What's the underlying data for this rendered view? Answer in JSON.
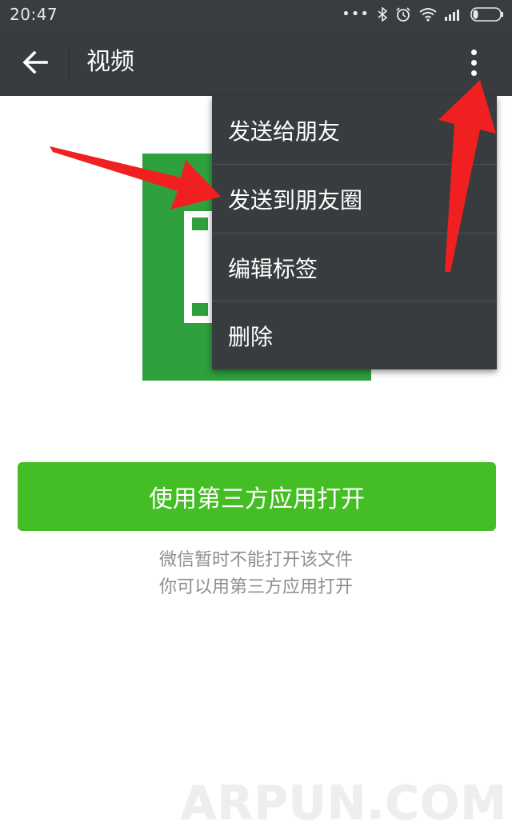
{
  "status_bar": {
    "time": "20:47",
    "icons": [
      "more-dots-icon",
      "bluetooth-icon",
      "alarm-icon",
      "wifi-icon",
      "signal-icon",
      "battery-icon"
    ]
  },
  "app_bar": {
    "title": "视频",
    "back_icon": "back-arrow-icon",
    "more_icon": "more-vertical-icon"
  },
  "menu": {
    "items": [
      {
        "label": "发送给朋友"
      },
      {
        "label": "发送到朋友圈"
      },
      {
        "label": "编辑标签"
      },
      {
        "label": "删除"
      }
    ]
  },
  "main": {
    "open_button_label": "使用第三方应用打开",
    "hint_line1": "微信暂时不能打开该文件",
    "hint_line2": "你可以用第三方应用打开"
  },
  "watermark": "ARPUN.COM",
  "colors": {
    "app_bar": "#393c3e",
    "status_bar": "#3a3d3f",
    "accent_green": "#44be24",
    "file_green": "#2ea13e",
    "annotation_red": "#f02020"
  }
}
